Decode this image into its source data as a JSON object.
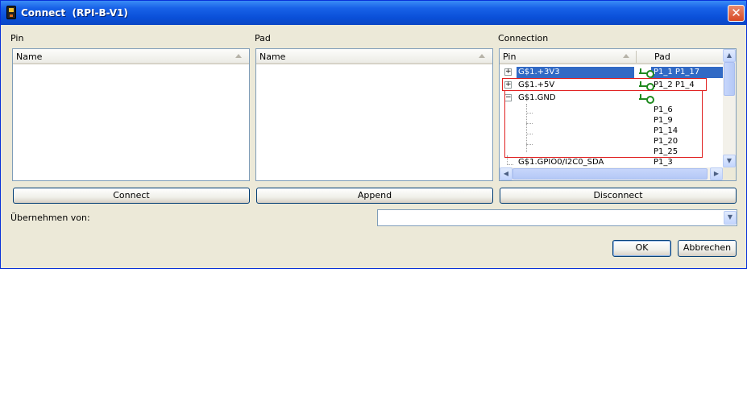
{
  "window": {
    "title": "Connect  (RPI-B-V1)",
    "close_glyph": "✕"
  },
  "pin_panel": {
    "label": "Pin",
    "column": "Name"
  },
  "pad_panel": {
    "label": "Pad",
    "column": "Name"
  },
  "connection_panel": {
    "label": "Connection",
    "columns": [
      "Pin",
      "Pad"
    ],
    "rows": [
      {
        "pin": "G$1.+3V3",
        "pad": "P1_1 P1_17",
        "expander": "+",
        "selected": true
      },
      {
        "pin": "G$1.+5V",
        "pad": "P1_2 P1_4",
        "expander": "+",
        "selected": false
      },
      {
        "pin": "G$1.GND",
        "pad": "",
        "expander": "−",
        "selected": false
      }
    ],
    "gnd_children": [
      "P1_6",
      "P1_9",
      "P1_14",
      "P1_20",
      "P1_25"
    ],
    "last_row": {
      "pin": "G$1.GPIO0/I2C0_SDA",
      "pad": "P1_3"
    }
  },
  "buttons": {
    "connect": "Connect",
    "append": "Append",
    "disconnect": "Disconnect",
    "ok": "OK",
    "cancel": "Abbrechen"
  },
  "uebernehmen": {
    "label": "Übernehmen von:",
    "value": ""
  },
  "colors": {
    "titlebar": "#0a4fd8",
    "selection": "#316ac5",
    "highlight_box": "#e02020",
    "connection_icon": "#1f8a1f"
  }
}
